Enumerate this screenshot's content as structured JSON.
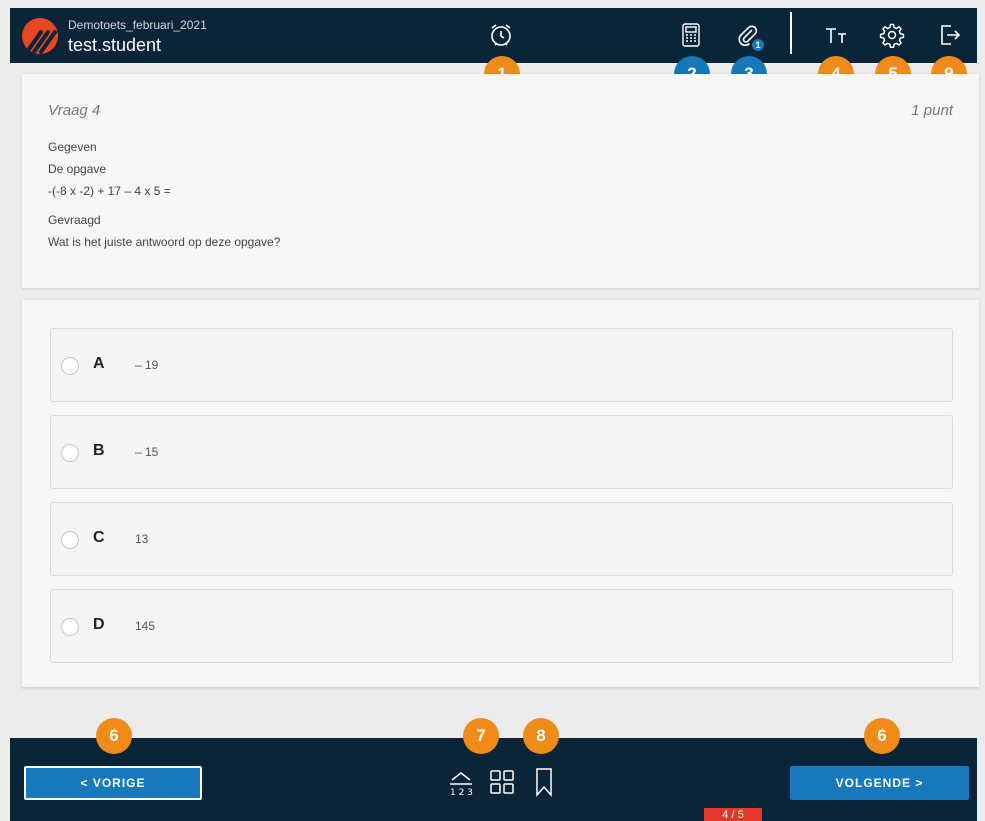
{
  "header": {
    "test_name": "Demotoets_februari_2021",
    "user": "test.student",
    "attachment_count": "1",
    "icons": [
      "logo",
      "alarm-clock-icon",
      "calculator-icon",
      "paperclip-icon",
      "font-size-icon",
      "gear-icon",
      "logout-icon"
    ]
  },
  "badges": {
    "timer": "1",
    "calculator": "2",
    "attachments": "3",
    "font_size": "4",
    "settings": "5",
    "prev": "6",
    "next": "6",
    "ordering": "7",
    "overview": "8",
    "logout": "9"
  },
  "question": {
    "title": "Vraag 4",
    "points": "1 punt",
    "given_label": "Gegeven",
    "task_label": "De opgave",
    "expression": "-(-8 x -2) + 17 – 4 x 5 =",
    "asked_label": "Gevraagd",
    "asked_text": "Wat is het juiste antwoord op deze opgave?"
  },
  "options": [
    {
      "letter": "A",
      "text": "– 19"
    },
    {
      "letter": "B",
      "text": "– 15"
    },
    {
      "letter": "C",
      "text": "13"
    },
    {
      "letter": "D",
      "text": "145"
    }
  ],
  "footer": {
    "prev_label": "<  VORIGE",
    "next_label": "VOLGENDE  >",
    "progress": "4 / 5",
    "current_question": 4,
    "total_questions": 5
  },
  "colors": {
    "navy": "#0b2538",
    "accent_blue": "#1778bc",
    "badge_orange": "#f08a18",
    "badge_blue": "#1478b9",
    "progress_red": "#e2372a",
    "logo_orange": "#e5481f"
  }
}
